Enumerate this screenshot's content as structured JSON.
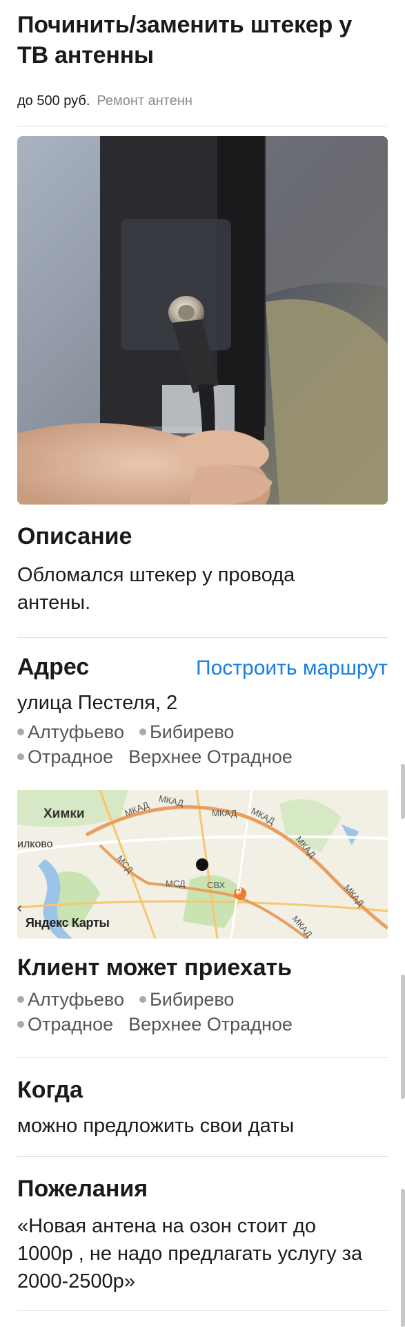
{
  "order": {
    "title": "Починить/заменить штекер у ТВ антенны",
    "price": "до 500 руб.",
    "category": "Ремонт антенн"
  },
  "description": {
    "heading": "Описание",
    "text": "Обломался штекер у провода антены."
  },
  "address": {
    "heading": "Адрес",
    "route_link": "Построить маршрут",
    "street": "улица Пестеля, 2",
    "stations": [
      {
        "name": "Алтуфьево",
        "dot": true
      },
      {
        "name": "Бибирево",
        "dot": true
      },
      {
        "name": "Отрадное",
        "dot": true
      },
      {
        "name": "Верхнее Отрадное",
        "dot": false
      }
    ]
  },
  "map": {
    "brand": "Яндекс Карты",
    "labels": {
      "city": "Химки",
      "city_partial": "илково",
      "ring1": "МКАД",
      "ring2": "МКАД",
      "ring3": "МКАД",
      "ring4": "МКАД",
      "ring5": "МКАД",
      "ring6": "МКАД",
      "ring7": "МКАД",
      "mcd1": "МСД",
      "mcd2": "МСД",
      "mcd3": "МСД",
      "svh": "СВХ",
      "ruble_icon": "₽",
      "chevron": "‹"
    }
  },
  "client_travel": {
    "heading": "Клиент может приехать",
    "stations": [
      {
        "name": "Алтуфьево",
        "dot": true
      },
      {
        "name": "Бибирево",
        "dot": true
      },
      {
        "name": "Отрадное",
        "dot": true
      },
      {
        "name": "Верхнее Отрадное",
        "dot": false
      }
    ]
  },
  "when": {
    "heading": "Когда",
    "text": "можно предложить свои даты"
  },
  "wishes": {
    "heading": "Пожелания",
    "text": "«Новая антена на озон стоит до 1000р , не надо предлагать услугу за 2000-2500р»"
  },
  "colors": {
    "link": "#1a7ee0",
    "divider": "#dddddd",
    "muted": "#8a8a8a",
    "map_road": "#f5c770",
    "map_ring": "#e99e60",
    "map_water": "#9cc4e8",
    "map_park": "#c9e3b3"
  },
  "icons": {
    "photo": "antenna-plug-photo",
    "map_point": "location-dot-icon",
    "ruble": "ruble-icon"
  }
}
